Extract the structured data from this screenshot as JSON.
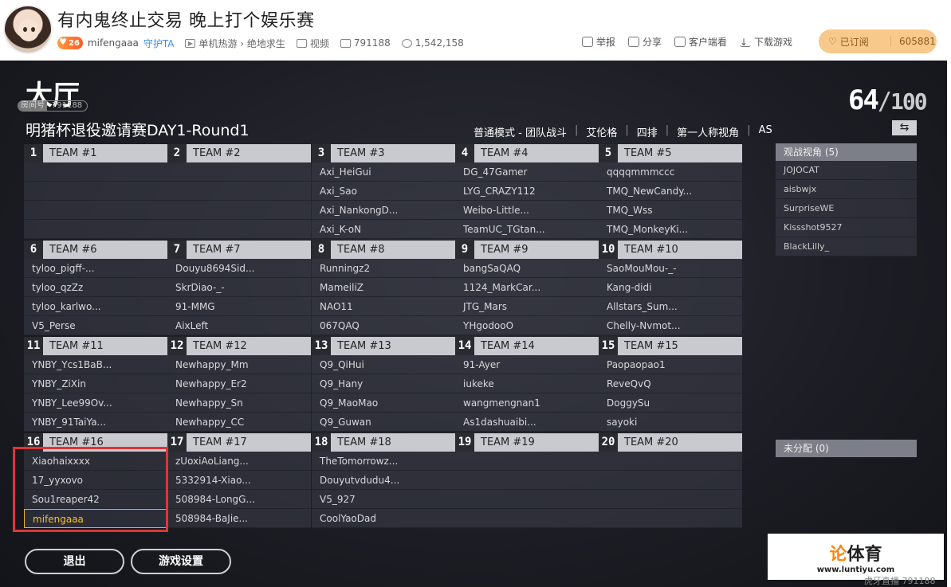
{
  "header": {
    "stream_title": "有内鬼终止交易 晚上打个娱乐赛",
    "level": "26",
    "streamer": "mifengaaa",
    "guard_label": "守护TA",
    "category": "单机热游 › 绝地求生",
    "video_label": "视频",
    "room_id": "791188",
    "followers": "1,542,158",
    "actions": [
      "举报",
      "分享",
      "客户端看",
      "下载游戏"
    ],
    "subscribe_label": "已订阅",
    "subscribe_count": "605881"
  },
  "lobby": {
    "title": "大厅",
    "room_badge_key": "房间号",
    "room_badge_val": "791188",
    "match_title": "明猪杯退役邀请赛DAY1-Round1",
    "mode": [
      "普通模式 - 团队战斗",
      "艾伦格",
      "四排",
      "第一人称视角",
      "AS"
    ],
    "count_current": "64",
    "count_total": "100",
    "swap_icon": "⇆",
    "teams": [
      {
        "num": "1",
        "name": "TEAM #1",
        "players": [
          "",
          "",
          "",
          ""
        ]
      },
      {
        "num": "2",
        "name": "TEAM #2",
        "players": [
          "",
          "",
          "",
          ""
        ]
      },
      {
        "num": "3",
        "name": "TEAM #3",
        "players": [
          "Axi_HeiGui",
          "Axi_Sao",
          "Axi_NankongD...",
          "Axi_K-oN"
        ]
      },
      {
        "num": "4",
        "name": "TEAM #4",
        "players": [
          "DG_47Gamer",
          "LYG_CRAZY112",
          "Weibo-Little...",
          "TeamUC_TGtan..."
        ]
      },
      {
        "num": "5",
        "name": "TEAM #5",
        "players": [
          "qqqqmmmccc",
          "TMQ_NewCandy...",
          "TMQ_Wss",
          "TMQ_MonkeyKi..."
        ]
      },
      {
        "num": "6",
        "name": "TEAM #6",
        "players": [
          "tyloo_pigff-...",
          "tyloo_qzZz",
          "tyloo_karlwo...",
          "V5_Perse"
        ]
      },
      {
        "num": "7",
        "name": "TEAM #7",
        "players": [
          "Douyu8694Sid...",
          "SkrDiao-_-",
          "91-MMG",
          "AixLeft"
        ]
      },
      {
        "num": "8",
        "name": "TEAM #8",
        "players": [
          "Runningz2",
          "MameiliZ",
          "NAO11",
          "067QAQ"
        ]
      },
      {
        "num": "9",
        "name": "TEAM #9",
        "players": [
          "bangSaQAQ",
          "1124_MarkCar...",
          "JTG_Mars",
          "YHgodooO"
        ]
      },
      {
        "num": "10",
        "name": "TEAM #10",
        "players": [
          "SaoMouMou-_-",
          "Kang-didi",
          "Allstars_Sum...",
          "Chelly-Nvmot..."
        ]
      },
      {
        "num": "11",
        "name": "TEAM #11",
        "players": [
          "YNBY_Ycs1BaB...",
          "YNBY_ZiXin",
          "YNBY_Lee99Ov...",
          "YNBY_91TaiYa..."
        ]
      },
      {
        "num": "12",
        "name": "TEAM #12",
        "players": [
          "Newhappy_Mm",
          "Newhappy_Er2",
          "Newhappy_Sn",
          "Newhappy_CC"
        ]
      },
      {
        "num": "13",
        "name": "TEAM #13",
        "players": [
          "Q9_QiHui",
          "Q9_Hany",
          "Q9_MaoMao",
          "Q9_Guwan"
        ]
      },
      {
        "num": "14",
        "name": "TEAM #14",
        "players": [
          "91-Ayer",
          "iukeke",
          "wangmengnan1",
          "As1dashuaibi..."
        ]
      },
      {
        "num": "15",
        "name": "TEAM #15",
        "players": [
          "Paopaopao1",
          "ReveQvQ",
          "DoggySu",
          "sayoki"
        ]
      },
      {
        "num": "16",
        "name": "TEAM #16",
        "players": [
          "Xiaohaixxxx",
          "17_yyxovo",
          "Sou1reaper42",
          "mifengaaa"
        ]
      },
      {
        "num": "17",
        "name": "TEAM #17",
        "players": [
          "zUoxiAoLiang...",
          "5332914-Xiao...",
          "508984-LongG...",
          "508984-BaJie..."
        ]
      },
      {
        "num": "18",
        "name": "TEAM #18",
        "players": [
          "TheTomorrowz...",
          "Douyutvdudu4...",
          "V5_927",
          "CoolYaoDad"
        ]
      },
      {
        "num": "19",
        "name": "TEAM #19",
        "players": [
          "",
          "",
          "",
          ""
        ]
      },
      {
        "num": "20",
        "name": "TEAM #20",
        "players": [
          "",
          "",
          "",
          ""
        ]
      }
    ],
    "spectate_title": "观战视角 (5)",
    "spectators": [
      "JOJOCAT",
      "aisbwjx",
      "SurpriseWE",
      "Kissshot9527",
      "BlackLilly_"
    ],
    "unassigned_title": "未分配 (0)",
    "exit_label": "退出",
    "settings_label": "游戏设置"
  },
  "watermark": {
    "prefix": "论",
    "main": "体育",
    "url": "www.luntiyu.com",
    "corner": "虎牙直播 791188"
  },
  "colors": {
    "highlight": "#e03434",
    "self_player": "#f2c233",
    "subscribe_bg": "#f7c98a"
  }
}
